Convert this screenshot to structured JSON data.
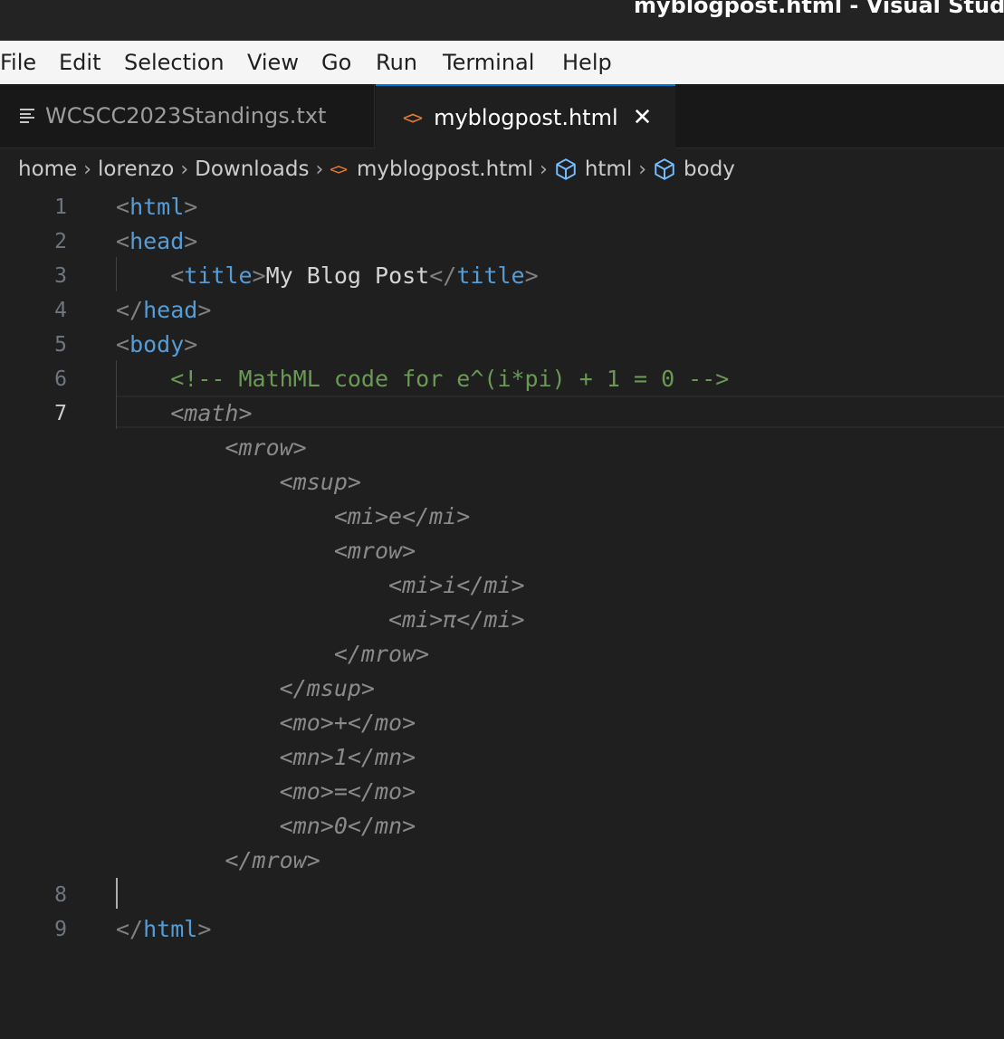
{
  "window": {
    "title": "myblogpost.html - Visual Studio"
  },
  "menu": {
    "items": [
      "File",
      "Edit",
      "Selection",
      "View",
      "Go",
      "Run",
      "Terminal",
      "Help"
    ]
  },
  "tabs": [
    {
      "label": "WCSCC2023Standings.txt",
      "icon": "text-file-icon",
      "active": false
    },
    {
      "label": "myblogpost.html",
      "icon": "code-file-icon",
      "active": true,
      "close": "✕"
    }
  ],
  "breadcrumbs": {
    "items": [
      "home",
      "lorenzo",
      "Downloads",
      "myblogpost.html",
      "html",
      "body"
    ],
    "separator": "›",
    "code_icon": "<>"
  },
  "editor": {
    "current_line": "7",
    "line_numbers": [
      "1",
      "2",
      "3",
      "4",
      "5",
      "6",
      "7",
      "8",
      "9"
    ],
    "lines": {
      "l1": {
        "open": "<",
        "tag": "html",
        "close": ">"
      },
      "l2": {
        "open": "<",
        "tag": "head",
        "close": ">"
      },
      "l3": {
        "open": "<",
        "tag": "title",
        "close": ">",
        "text": "My Blog Post",
        "end_open": "</",
        "end_tag": "title",
        "end_close": ">"
      },
      "l4": {
        "open": "</",
        "tag": "head",
        "close": ">"
      },
      "l5": {
        "open": "<",
        "tag": "body",
        "close": ">"
      },
      "l6": {
        "comment": "<!-- MathML code for e^(i*pi) + 1 = 0 -->"
      },
      "l9": {
        "open": "</",
        "tag": "html",
        "close": ">"
      }
    },
    "suggestion": [
      "<math>",
      "<mrow>",
      "<msup>",
      "<mi>e</mi>",
      "<mrow>",
      "<mi>i</mi>",
      "<mi>π</mi>",
      "</mrow>",
      "</msup>",
      "<mo>+</mo>",
      "<mn>1</mn>",
      "<mo>=</mo>",
      "<mn>0</mn>",
      "</mrow>"
    ]
  },
  "colors": {
    "tag": "#569cd6",
    "punctuation": "#808080",
    "comment": "#6a9955",
    "ghost_text": "#8a8a8a",
    "accent": "#0078d4",
    "file_icon": "#e37933"
  }
}
